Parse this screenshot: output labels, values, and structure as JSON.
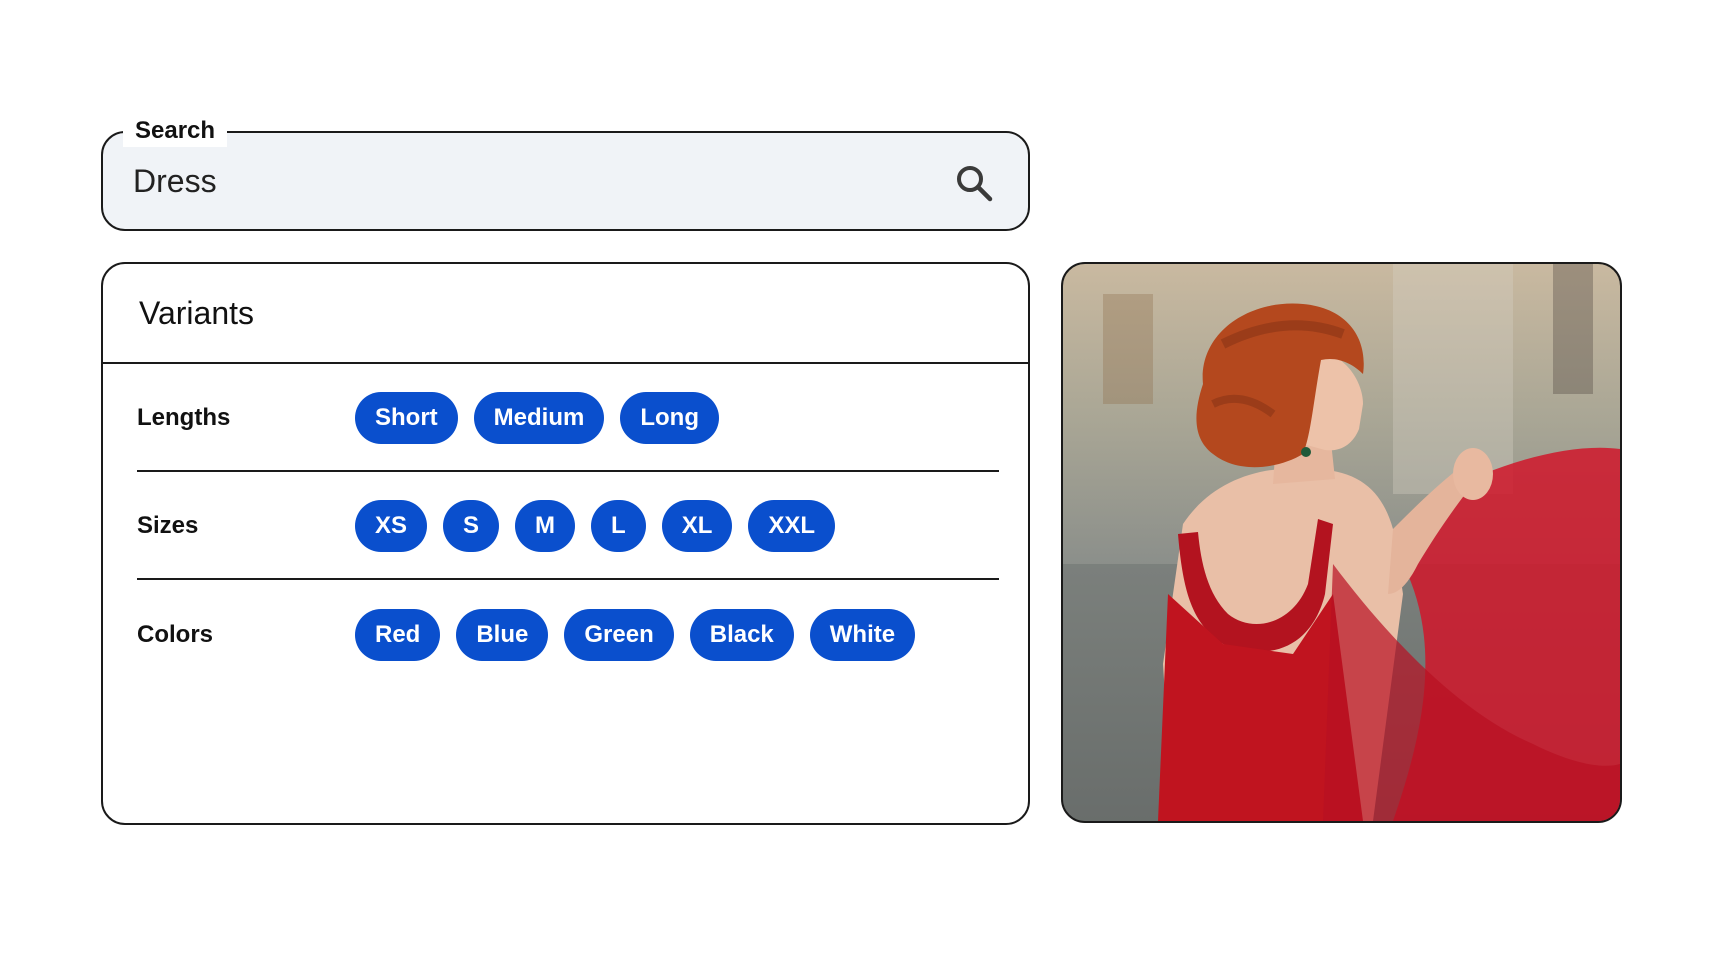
{
  "search": {
    "label": "Search",
    "value": "Dress",
    "icon": "search-icon"
  },
  "variants": {
    "title": "Variants",
    "rows": [
      {
        "label": "Lengths",
        "options": [
          "Short",
          "Medium",
          "Long"
        ]
      },
      {
        "label": "Sizes",
        "options": [
          "XS",
          "S",
          "M",
          "L",
          "XL",
          "XXL"
        ]
      },
      {
        "label": "Colors",
        "options": [
          "Red",
          "Blue",
          "Green",
          "Black",
          "White"
        ]
      }
    ]
  },
  "colors": {
    "chip_bg": "#0a4fcd",
    "chip_text": "#ffffff",
    "border": "#1a1a1a",
    "search_bg": "#f0f3f7"
  }
}
